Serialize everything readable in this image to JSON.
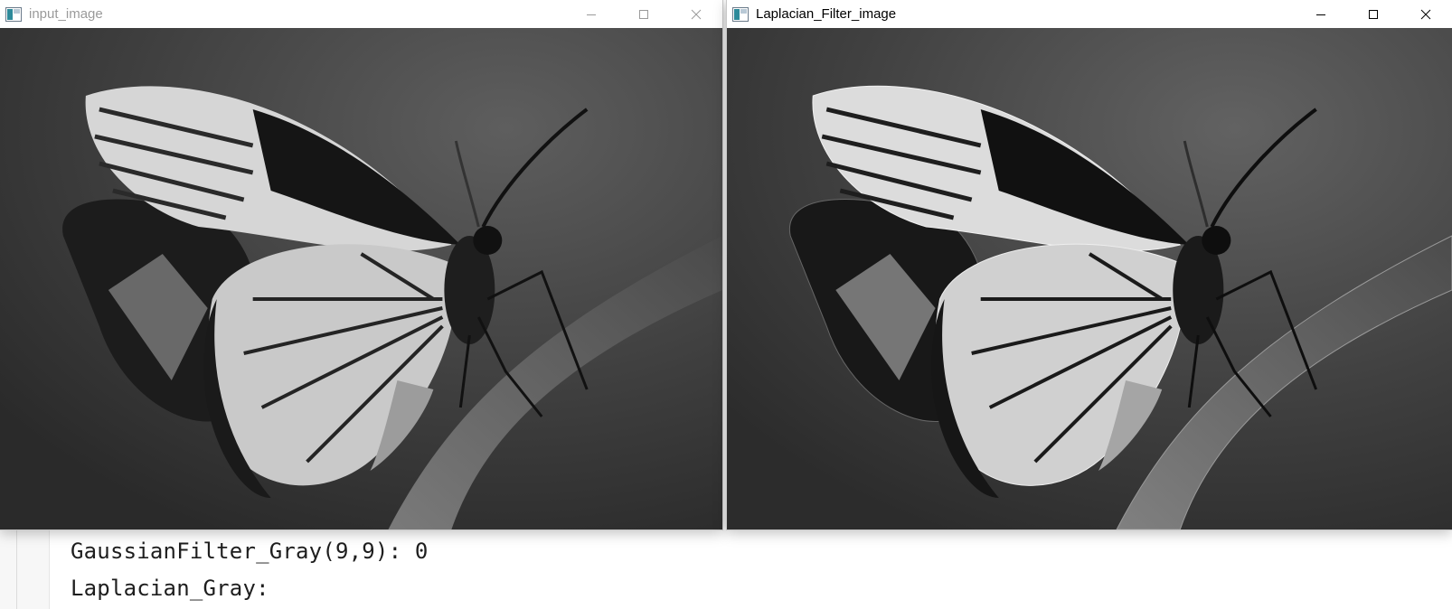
{
  "windows": [
    {
      "title": "input_image",
      "active": false,
      "controls": {
        "minimize": "minimize-icon",
        "maximize": "maximize-icon",
        "close": "close-icon"
      },
      "image": "grayscale-butterfly-photo"
    },
    {
      "title": "Laplacian_Filter_image",
      "active": true,
      "controls": {
        "minimize": "minimize-icon",
        "maximize": "maximize-icon",
        "close": "close-icon"
      },
      "image": "sharpened-grayscale-butterfly-photo"
    }
  ],
  "console": {
    "lines": [
      "GaussianFilter_Gray(9,9): 0",
      "Laplacian_Gray:"
    ]
  },
  "colors": {
    "inactive_title": "#9a9a9a",
    "active_title": "#000000",
    "image_background": "#3d3d3d"
  }
}
